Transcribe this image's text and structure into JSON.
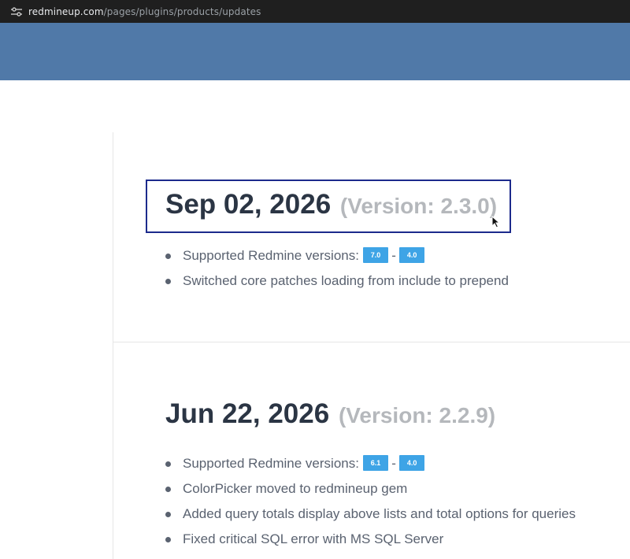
{
  "browser": {
    "url_host": "redmineup.com",
    "url_path": "/pages/plugins/products/updates"
  },
  "icons": {
    "address_bar": "tune-icon",
    "cursor": "mouse-pointer-icon"
  },
  "colors": {
    "header": "#5079a8",
    "badge": "#3ea4e6",
    "focus_outline": "#1c2a8c"
  },
  "releases": [
    {
      "date": "Sep 02, 2026",
      "version": "(Version: 2.3.0)",
      "changes": [
        {
          "label": "Supported Redmine versions:",
          "badge_from": "7.0",
          "dash": "-",
          "badge_to": "4.0"
        },
        {
          "label": "Switched core patches loading from include to prepend"
        }
      ]
    },
    {
      "date": "Jun 22, 2026",
      "version": "(Version: 2.2.9)",
      "changes": [
        {
          "label": "Supported Redmine versions:",
          "badge_from": "6.1",
          "dash": "-",
          "badge_to": "4.0"
        },
        {
          "label": "ColorPicker moved to redmineup gem"
        },
        {
          "label": "Added query totals display above lists and total options for queries"
        },
        {
          "label": "Fixed critical SQL error with MS SQL Server"
        }
      ]
    }
  ]
}
